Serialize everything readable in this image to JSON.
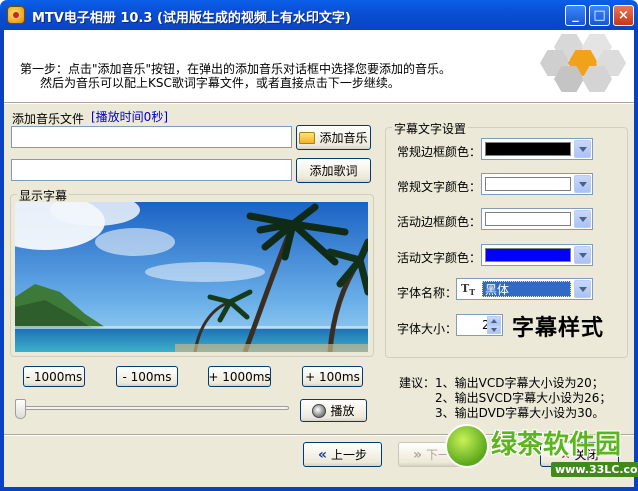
{
  "window": {
    "title": "MTV电子相册 10.3 (试用版生成的视频上有水印文字)",
    "min_label": "_",
    "max_label": "□",
    "close_label": "×"
  },
  "header": {
    "line1": "第一步：点击\"添加音乐\"按钮，在弹出的添加音乐对话框中选择您要添加的音乐。",
    "line2": "然后为音乐可以配上KSC歌词字幕文件，或者直接点击下一步继续。"
  },
  "music": {
    "label": "添加音乐文件",
    "duration_label": "[播放时间0秒]",
    "music_path": "",
    "lyrics_path": "",
    "add_music_button": "添加音乐",
    "add_lyrics_button": "添加歌词"
  },
  "preview": {
    "group_title": "显示字幕"
  },
  "seek": {
    "minus_1000": "- 1000ms",
    "minus_100": "- 100ms",
    "plus_1000": "+ 1000ms",
    "plus_100": "+ 100ms",
    "play_button": "播放",
    "position": 0
  },
  "subtitle_settings": {
    "group_title": "字幕文字设置",
    "normal_border_label": "常规边框颜色：",
    "normal_border_color": "#000000",
    "normal_text_label": "常规文字颜色：",
    "normal_text_color": "#ffffff",
    "active_border_label": "活动边框颜色：",
    "active_border_color": "#ffffff",
    "active_text_label": "活动文字颜色：",
    "active_text_color": "#0000ff",
    "font_name_label": "字体名称：",
    "font_name_value": "黑体",
    "font_size_label": "字体大小：",
    "font_size_value": "20",
    "sample_text": "字幕样式"
  },
  "advice": {
    "label": "建议：",
    "item1": "1、输出VCD字幕大小设为20；",
    "item2": "2、输出SVCD字幕大小设为26；",
    "item3": "3、输出DVD字幕大小设为30。"
  },
  "nav": {
    "prev_button": "上一步",
    "next_button": "下一步",
    "close_button": "关闭"
  },
  "watermark": {
    "text": "绿茶软件园",
    "url": "www.33LC.com"
  },
  "colors": {
    "titlebar": "#0a4fd6",
    "frame": "#0842c0",
    "dialog_bg": "#ece9d8",
    "accent_blue": "#0000c8",
    "selection": "#316ac5"
  }
}
